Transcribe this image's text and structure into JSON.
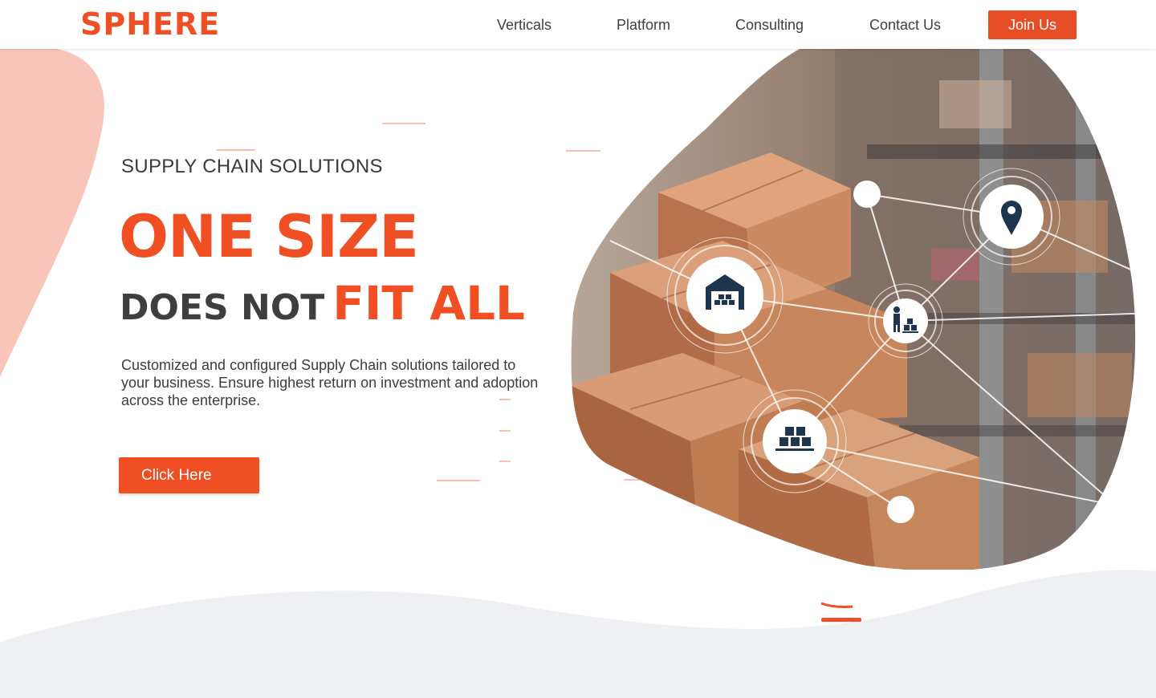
{
  "header": {
    "logo": "SPHERE",
    "nav": [
      {
        "label": "Verticals"
      },
      {
        "label": "Platform"
      },
      {
        "label": "Consulting"
      },
      {
        "label": "Contact Us"
      }
    ],
    "join_label": "Join Us"
  },
  "hero": {
    "eyebrow": "SUPPLY CHAIN SOLUTIONS",
    "headline_line1": "ONE SIZE",
    "headline_line2_dark": "DOES NOT",
    "headline_line2_accent": "FIT ALL",
    "description": "Customized and configured Supply Chain solutions tailored to your business. Ensure highest return on investment and adoption across the enterprise.",
    "cta_label": "Click Here",
    "illustration_icons": [
      "warehouse-icon",
      "location-pin-icon",
      "worker-boxes-icon",
      "pallet-boxes-icon"
    ]
  },
  "colors": {
    "brand": "#f04e23",
    "blob": "#f8c5b8",
    "wave": "#eef0f4",
    "icon_navy": "#1e3550"
  }
}
